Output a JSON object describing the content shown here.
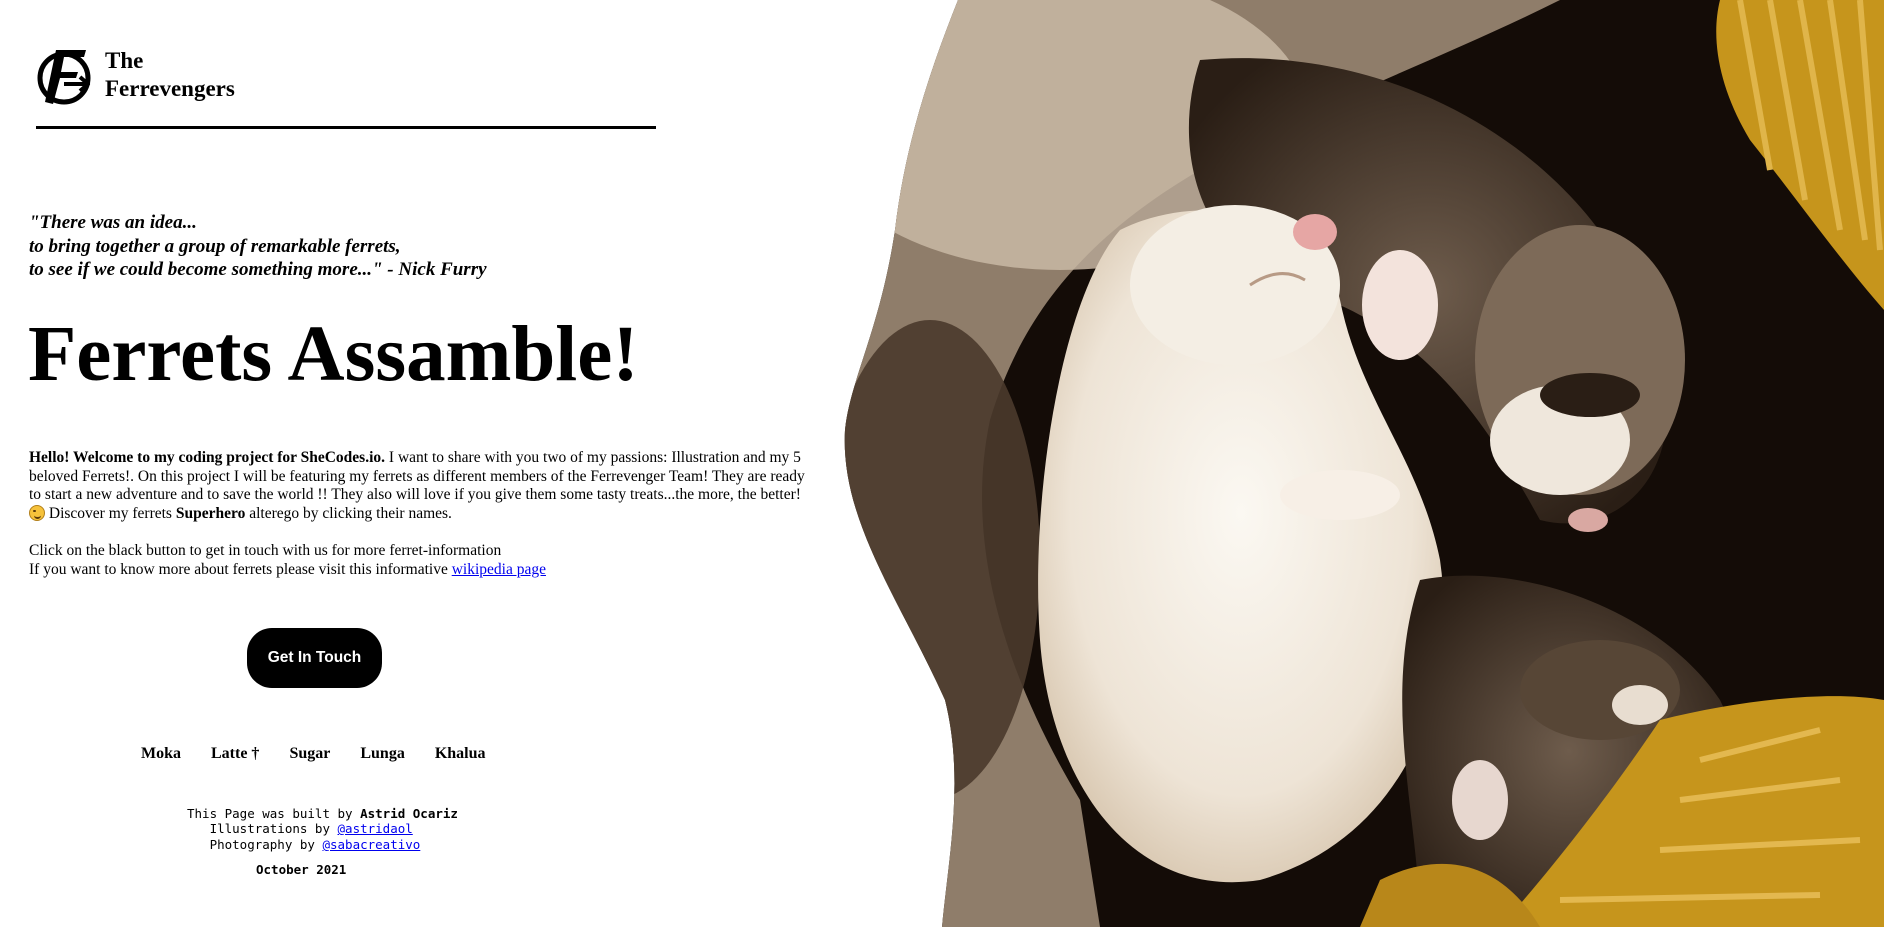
{
  "header": {
    "brand_line1": "The",
    "brand_line2": "Ferrevengers"
  },
  "quote": {
    "line1": "\"There was an idea...",
    "line2": "to bring together a group of remarkable ferrets,",
    "line3": "to see if we could become something more...\" - Nick Furry"
  },
  "headline": "Ferrets Assamble!",
  "intro": {
    "greeting": "Hello! Welcome to my coding project for SheCodes.io.",
    "text1": " I want to share with you two of my passions: Illustration and my 5 beloved Ferrets!. On this project I will be featuring my ferrets as different members of the Ferrevenger Team! They are ready to start a new adventure and to save the world !! They also will love if you give them some tasty treats...the more, the better! ",
    "emoji_icon": "grinning-face-emoji",
    "text2": " Discover my ferrets ",
    "superhero": "Superhero",
    "text3": " alterego by clicking their names."
  },
  "contact": {
    "line1": "Click on the black button to get in touch with us for more ferret-information",
    "line2_prefix": "If you want to know more about ferrets please visit this informative ",
    "wiki_link": "wikipedia page"
  },
  "cta_label": "Get In Touch",
  "ferrets": [
    "Moka",
    "Latte †",
    "Sugar",
    "Lunga",
    "Khalua"
  ],
  "credits": {
    "built_prefix": "This Page was built by ",
    "author": "Astrid Ocariz",
    "illus_prefix": "Illustrations by ",
    "illus_handle": "@astridaol",
    "photo_prefix": "Photography by ",
    "photo_handle": "@sabacreativo",
    "date": "October 2021"
  },
  "colors": {
    "background": "#ffffff",
    "text": "#000000",
    "button": "#000000",
    "link": "#0000ee",
    "fur_dark": "#2a1e15",
    "fur_light": "#f1ebe1",
    "blanket_yellow": "#c6951c"
  },
  "icons": {
    "logo": "ferrevengers-logo-icon"
  }
}
